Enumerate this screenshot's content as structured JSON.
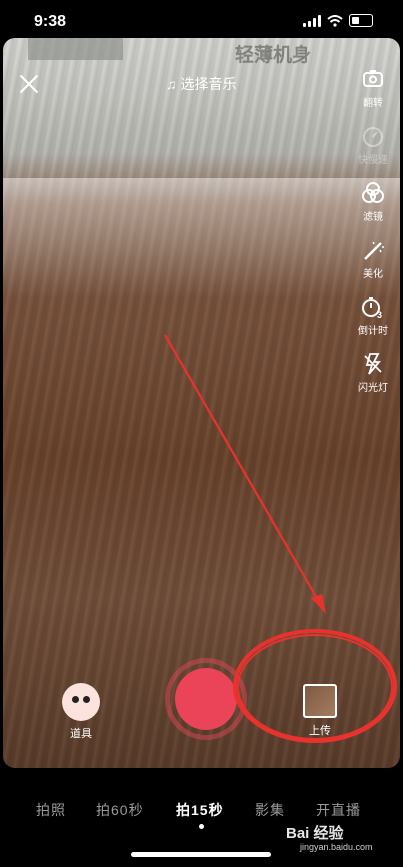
{
  "status": {
    "time": "9:38"
  },
  "top": {
    "music_label": "选择音乐"
  },
  "sidebar": {
    "items": [
      {
        "icon": "flip-camera-icon",
        "label": "翻转",
        "faded": false
      },
      {
        "icon": "speed-icon",
        "label": "快慢速",
        "faded": true
      },
      {
        "icon": "filter-icon",
        "label": "滤镜",
        "faded": false
      },
      {
        "icon": "beauty-wand-icon",
        "label": "美化",
        "faded": false
      },
      {
        "icon": "countdown-timer-icon",
        "label": "倒计时",
        "faded": false
      },
      {
        "icon": "flash-icon",
        "label": "闪光灯",
        "faded": false
      }
    ]
  },
  "bottom": {
    "props_label": "道具",
    "upload_label": "上传"
  },
  "modes": [
    {
      "label": "拍照",
      "active": false
    },
    {
      "label": "拍60秒",
      "active": false
    },
    {
      "label": "拍15秒",
      "active": true
    },
    {
      "label": "影集",
      "active": false
    },
    {
      "label": "开直播",
      "active": false
    }
  ],
  "scene": {
    "sign_text": "轻薄机身"
  },
  "watermark": {
    "brand": "Bai 经验",
    "url": "jingyan.baidu.com"
  },
  "annotation_color": "#e8322e",
  "record_color": "#eb4357"
}
